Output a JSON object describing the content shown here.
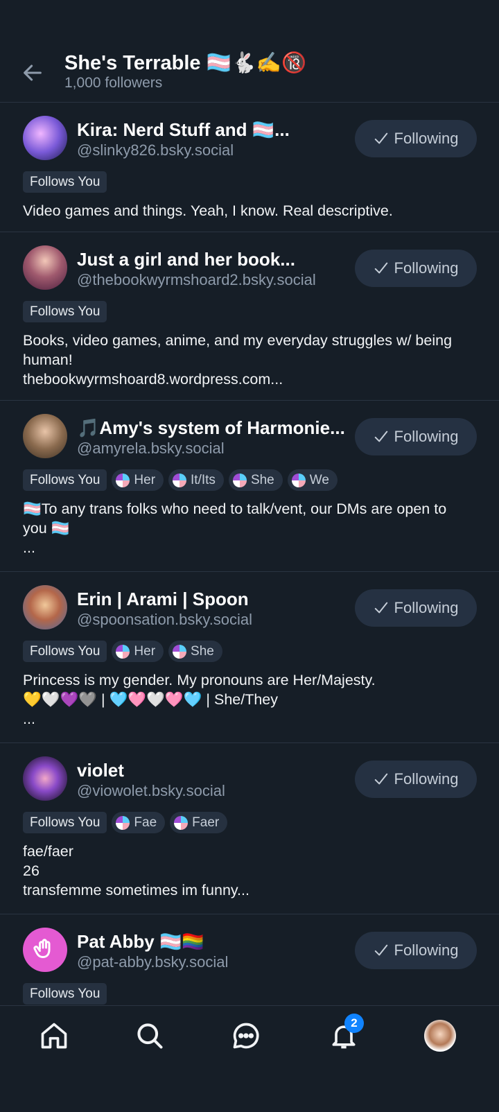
{
  "header": {
    "title": "She's Terrable 🏳️‍⚧️🐇✍️🔞",
    "subtitle": "1,000 followers"
  },
  "follow_label": "Following",
  "users": [
    {
      "name": "Kira: Nerd Stuff and 🏳️‍⚧️...",
      "handle": "@slinky826.bsky.social",
      "follows_you": "Follows You",
      "pronouns": [],
      "bio": "Video games and things. Yeah, I know. Real descriptive."
    },
    {
      "name": "Just a girl and her book...",
      "handle": "@thebookwyrmshoard2.bsky.social",
      "follows_you": "Follows You",
      "pronouns": [],
      "bio": "Books, video games, anime, and my everyday struggles w/ being human!\nthebookwyrmshoard8.wordpress.com..."
    },
    {
      "name": "🎵Amy's system of Harmonie...",
      "handle": "@amyrela.bsky.social",
      "follows_you": "Follows You",
      "pronouns": [
        "Her",
        "It/Its",
        "She",
        "We"
      ],
      "bio": "🏳️‍⚧️To any trans folks who need to talk/vent, our DMs are open to you 🏳️‍⚧️\n..."
    },
    {
      "name": "Erin | Arami | Spoon",
      "handle": "@spoonsation.bsky.social",
      "follows_you": "Follows You",
      "pronouns": [
        "Her",
        "She"
      ],
      "bio": "Princess is my gender. My pronouns are Her/Majesty.\n💛🤍💜🩶 | 🩵🩷🤍🩷🩵 | She/They\n..."
    },
    {
      "name": "violet",
      "handle": "@viowolet.bsky.social",
      "follows_you": "Follows You",
      "pronouns": [
        "Fae",
        "Faer"
      ],
      "bio": "fae/faer\n26\ntransfemme sometimes im funny..."
    },
    {
      "name": "Pat Abby 🏳️‍⚧️🏳️‍🌈",
      "handle": "@pat-abby.bsky.social",
      "follows_you": "Follows You",
      "pronouns": [],
      "bio": ""
    }
  ],
  "nav": {
    "items": [
      "home-icon",
      "search-icon",
      "chat-icon",
      "bell-icon",
      "profile-avatar"
    ],
    "notification_count": "2"
  },
  "colors": {
    "background": "#161e27",
    "button_bg": "#253142",
    "accent": "#1083fe",
    "muted_text": "#8e9bab"
  }
}
